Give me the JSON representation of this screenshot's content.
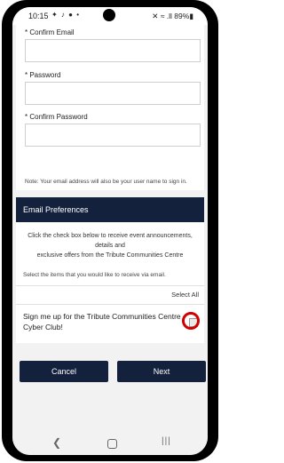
{
  "status_bar": {
    "time": "10:15",
    "left_icons": "✦ ♪ ● •",
    "right_status": "✕ ≈ .ll 89%▮"
  },
  "form": {
    "confirm_email_label": "* Confirm Email",
    "password_label": "* Password",
    "confirm_password_label": "* Confirm Password",
    "note": "Note: Your email address will also be your user name to sign in."
  },
  "email_preferences": {
    "title": "Email Preferences",
    "description_lines": [
      "Click the check box below to receive event announcements,",
      "details and",
      "exclusive offers from the Tribute Communities Centre"
    ],
    "select_prompt": "Select the items that you would like to receive via email.",
    "select_all": "Select All",
    "cyber_club_label": "Sign me up for the Tribute Communities Centre Cyber Club!",
    "cyber_club_checked": false,
    "highlight_color": "#d00000"
  },
  "buttons": {
    "cancel": "Cancel",
    "next": "Next"
  },
  "navbar": {
    "back_glyph": "❮",
    "recent_glyph": "|||"
  },
  "colors": {
    "accent_navy": "#14213d",
    "background": "#f2f2f2"
  }
}
